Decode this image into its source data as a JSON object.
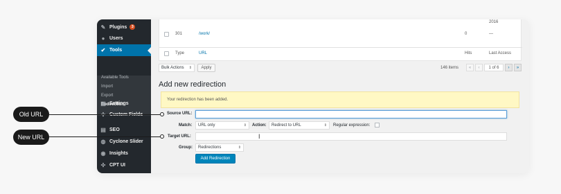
{
  "sidebar": {
    "items": [
      {
        "label": "Plugins",
        "badge": "3",
        "icon": "plugin-icon"
      },
      {
        "label": "Users",
        "icon": "users-icon"
      },
      {
        "label": "Tools",
        "icon": "wrench-icon"
      },
      {
        "label": "Settings",
        "icon": "settings-icon"
      },
      {
        "label": "Custom Fields",
        "icon": "custom-fields-icon"
      },
      {
        "label": "SEO",
        "icon": "seo-icon"
      },
      {
        "label": "Cyclone Slider",
        "icon": "slider-icon"
      },
      {
        "label": "Insights",
        "icon": "insights-icon"
      },
      {
        "label": "CPT UI",
        "icon": "cpt-icon"
      }
    ],
    "submenu": [
      "Available Tools",
      "Import",
      "Export",
      "Redirection"
    ]
  },
  "table": {
    "partial_date": "2016",
    "row": {
      "type": "301",
      "url": "/work/",
      "hits": "0",
      "last_access": "—"
    },
    "headers": {
      "type": "Type",
      "url": "URL",
      "hits": "Hits",
      "last_access": "Last Access"
    }
  },
  "toolbar": {
    "bulk_actions": "Bulk Actions",
    "apply": "Apply",
    "items_count": "146 items",
    "first": "«",
    "prev": "‹",
    "page_info": "1 of 6",
    "next": "›",
    "last": "»"
  },
  "form": {
    "title": "Add new redirection",
    "notice": "Your redirection has been added.",
    "source_label": "Source URL:",
    "source_value": "",
    "match_label": "Match:",
    "match_value": "URL only",
    "action_label": "Action:",
    "action_value": "Redirect to URL",
    "regex_label": "Regular expression:",
    "target_label": "Target URL:",
    "target_value": "",
    "group_label": "Group:",
    "group_value": "Redirections",
    "submit": "Add Redirection"
  },
  "callouts": {
    "old_url": "Old URL",
    "new_url": "New URL"
  },
  "colors": {
    "sidebar_bg": "#23282d",
    "accent": "#0073aa",
    "notice_bg": "#fff8c4",
    "callout_bg": "#1a1a1a"
  }
}
